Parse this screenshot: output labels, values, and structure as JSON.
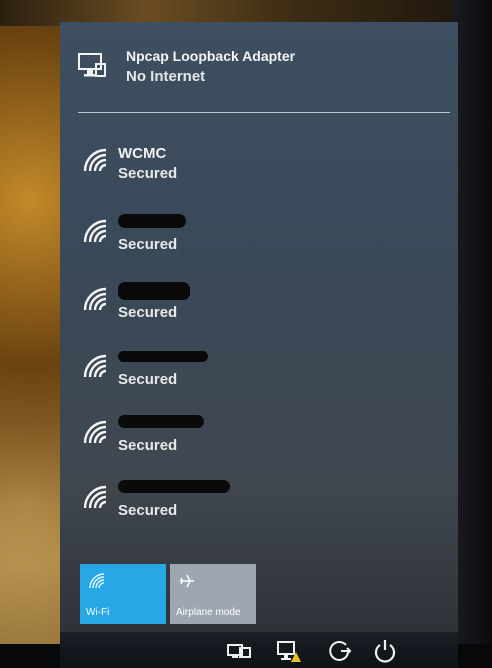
{
  "ethernet": {
    "name": "Npcap Loopback Adapter",
    "status": "No Internet",
    "icon": "ethernet-monitor-icon"
  },
  "networks": [
    {
      "ssid": "WCMC",
      "status": "Secured",
      "redacted": false
    },
    {
      "ssid": "",
      "status": "Secured",
      "redacted": true
    },
    {
      "ssid": "",
      "status": "Secured",
      "redacted": true
    },
    {
      "ssid": "",
      "status": "Secured",
      "redacted": true
    },
    {
      "ssid": "",
      "status": "Secured",
      "redacted": true
    },
    {
      "ssid": "",
      "status": "Secured",
      "redacted": true
    }
  ],
  "quick_actions": {
    "wifi": {
      "label": "Wi-Fi",
      "active": true
    },
    "airplane": {
      "label": "Airplane mode",
      "active": false
    }
  },
  "taskbar": {
    "icons": [
      "display-icon",
      "network-warning-icon",
      "update-icon",
      "power-icon"
    ]
  },
  "colors": {
    "accent": "#27a7e6",
    "inactive_tile": "#9ea7b1",
    "flyout_bg": "#3a4857"
  }
}
